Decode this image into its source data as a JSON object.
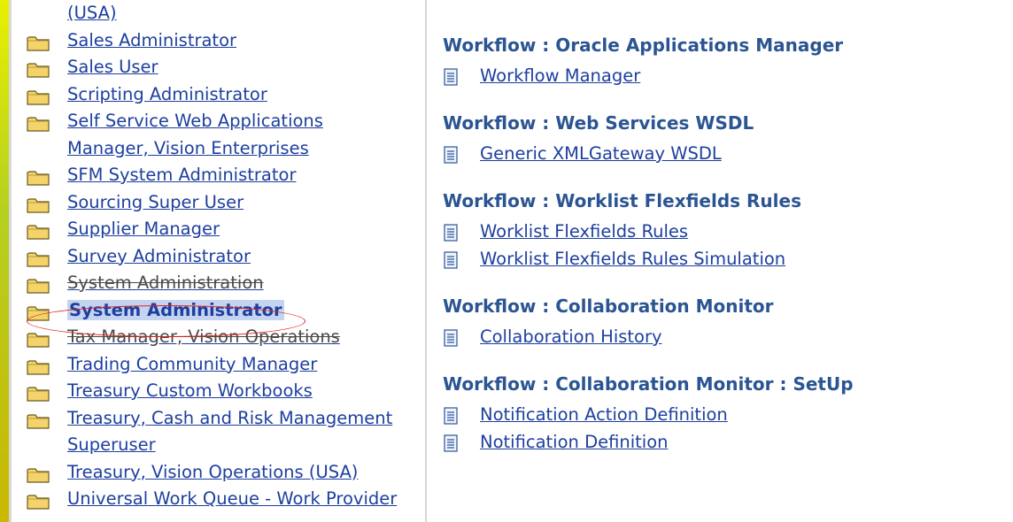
{
  "left_list": {
    "items": [
      {
        "text": "(USA)",
        "cont": true
      },
      {
        "text": "Sales Administrator"
      },
      {
        "text": "Sales User"
      },
      {
        "text": "Scripting Administrator"
      },
      {
        "text": "Self Service Web Applications"
      },
      {
        "text": "Manager, Vision Enterprises",
        "cont": true
      },
      {
        "text": "SFM System Administrator"
      },
      {
        "text": "Sourcing Super User"
      },
      {
        "text": "Supplier Manager"
      },
      {
        "text": "Survey Administrator"
      },
      {
        "text": "System Administration",
        "strike": true
      },
      {
        "text": "System Administrator",
        "selected": true
      },
      {
        "text": "Tax Manager, Vision Operations",
        "strike": true
      },
      {
        "text": "Trading Community Manager"
      },
      {
        "text": "Treasury Custom Workbooks"
      },
      {
        "text": "Treasury, Cash and Risk Management"
      },
      {
        "text": "Superuser",
        "cont": true
      },
      {
        "text": "Treasury, Vision Operations (USA)"
      },
      {
        "text": "Universal Work Queue - Work Provider"
      }
    ]
  },
  "sections": [
    {
      "heading": "Workflow : Oracle Applications Manager",
      "links": [
        "Workflow Manager"
      ]
    },
    {
      "heading": "Workflow : Web Services WSDL",
      "links": [
        "Generic XMLGateway WSDL"
      ]
    },
    {
      "heading": "Workflow : Worklist Flexfields Rules",
      "links": [
        "Worklist Flexfields Rules",
        "Worklist Flexfields Rules Simulation"
      ]
    },
    {
      "heading": "Workflow : Collaboration Monitor",
      "links": [
        "Collaboration History"
      ]
    },
    {
      "heading": "Workflow : Collaboration Monitor : SetUp",
      "links": [
        "Notification Action Definition",
        "Notification Definition"
      ]
    }
  ],
  "colors": {
    "link": "#1d3f9f",
    "heading": "#2b5592",
    "highlight_ellipse": "#e12222",
    "background": "#ffff22"
  },
  "icons": {
    "folder": "folder-icon",
    "document": "document-icon"
  }
}
